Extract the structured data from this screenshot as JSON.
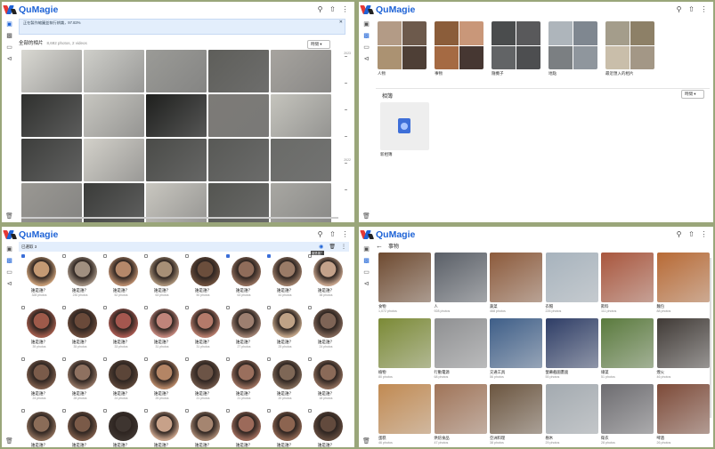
{
  "app": {
    "name": "QuMagie"
  },
  "panel1": {
    "banner_text": "正在製作縮圖並執行辨識，97.83%",
    "banner_sub": "",
    "section_title": "全部的相片",
    "count": "8,692 photos, 2 videos",
    "sort_label": "時間",
    "timeline": [
      "2023",
      "",
      "",
      "",
      "2022",
      ""
    ],
    "photos": [
      "#d9d8d2",
      "#cfcfca",
      "#9b9b97",
      "#5e5e5a",
      "#a7a49f",
      "#2f302e",
      "#c7c6c0",
      "#1e1f1d",
      "#7d7b77",
      "#c5c4bd",
      "#3d3e3c",
      "#d3d1ca",
      "#4a4b48",
      "#585956",
      "#6a6b68",
      "#9a9893",
      "#3a3b39",
      "#c9c7c0",
      "#545551",
      "#a8a7a2"
    ]
  },
  "panel2": {
    "categories": [
      {
        "label": "人物",
        "colors": [
          "#b39b86",
          "#6d5a4c",
          "#ab9272",
          "#4e3f36"
        ]
      },
      {
        "label": "事物",
        "colors": [
          "#8b5d3a",
          "#c99779",
          "#a56a43",
          "#463732"
        ]
      },
      {
        "label": "隨機子",
        "colors": [
          "#4a4c4d",
          "#59595b",
          "#626466",
          "#4d4e50"
        ]
      },
      {
        "label": "地點",
        "colors": [
          "#aeb5bb",
          "#7f8790",
          "#7b7f82",
          "#8f969d"
        ]
      },
      {
        "label": "最近匯入的相片",
        "colors": [
          "#a49d8b",
          "#8d8067",
          "#c9beaa",
          "#a39786"
        ]
      }
    ],
    "album_title": "相簿",
    "sort_label": "時間",
    "album_label": "新相簿"
  },
  "panel3": {
    "selection": "已選取 3",
    "faces": [
      {
        "name": "誰是誰？",
        "count": "328 photos",
        "color": "#c49a74",
        "checked": true
      },
      {
        "name": "誰是誰？",
        "count": "230 photos",
        "color": "#a08f80",
        "checked": false
      },
      {
        "name": "誰是誰？",
        "count": "52 photos",
        "color": "#b5886a",
        "checked": false
      },
      {
        "name": "誰是誰？",
        "count": "63 photos",
        "color": "#a78f76",
        "checked": false
      },
      {
        "name": "誰是誰？",
        "count": "50 photos",
        "color": "#6b4e3c",
        "checked": false
      },
      {
        "name": "誰是誰？",
        "count": "63 photos",
        "color": "#8f6c5a",
        "checked": true
      },
      {
        "name": "誰是誰？",
        "count": "44 photos",
        "color": "#9a7b67",
        "checked": true
      },
      {
        "name": "誰是誰？",
        "count": "38 photos",
        "color": "#c3a18a",
        "checked": false,
        "tip": "誰是誰？"
      },
      {
        "name": "誰是誰？",
        "count": "39 photos",
        "color": "#9e5a4a",
        "checked": false
      },
      {
        "name": "誰是誰？",
        "count": "35 photos",
        "color": "#6a4a3a",
        "checked": false
      },
      {
        "name": "誰是誰？",
        "count": "33 photos",
        "color": "#a4574f",
        "checked": false
      },
      {
        "name": "誰是誰？",
        "count": "31 photos",
        "color": "#c0847a",
        "checked": false
      },
      {
        "name": "誰是誰？",
        "count": "31 photos",
        "color": "#b47a6a",
        "checked": false
      },
      {
        "name": "誰是誰？",
        "count": "27 photos",
        "color": "#9d7f70",
        "checked": false
      },
      {
        "name": "誰是誰？",
        "count": "25 photos",
        "color": "#bfa286",
        "checked": false
      },
      {
        "name": "誰是誰？",
        "count": "24 photos",
        "color": "#7e6456",
        "checked": false
      },
      {
        "name": "誰是誰？",
        "count": "24 photos",
        "color": "#7a5b4a",
        "checked": false
      },
      {
        "name": "誰是誰？",
        "count": "28 photos",
        "color": "#8e7160",
        "checked": false
      },
      {
        "name": "誰是誰？",
        "count": "24 photos",
        "color": "#5b4538",
        "checked": false
      },
      {
        "name": "誰是誰？",
        "count": "25 photos",
        "color": "#b48565",
        "checked": false
      },
      {
        "name": "誰是誰？",
        "count": "21 photos",
        "color": "#6c5446",
        "checked": false
      },
      {
        "name": "誰是誰？",
        "count": "21 photos",
        "color": "#9a6f5d",
        "checked": false
      },
      {
        "name": "誰是誰？",
        "count": "20 photos",
        "color": "#7e6756",
        "checked": false
      },
      {
        "name": "誰是誰？",
        "count": "18 photos",
        "color": "#8a6a58",
        "checked": false
      },
      {
        "name": "誰是誰？",
        "count": "",
        "color": "#8a6c58",
        "checked": false
      },
      {
        "name": "誰是誰？",
        "count": "",
        "color": "#7a5a48",
        "checked": false
      },
      {
        "name": "誰是誰？",
        "count": "",
        "color": "#3e3530",
        "checked": false
      },
      {
        "name": "誰是誰？",
        "count": "",
        "color": "#c7a189",
        "checked": false
      },
      {
        "name": "誰是誰？",
        "count": "",
        "color": "#a58570",
        "checked": false
      },
      {
        "name": "誰是誰？",
        "count": "",
        "color": "#9c6a5a",
        "checked": false
      },
      {
        "name": "誰是誰？",
        "count": "",
        "color": "#8c6450",
        "checked": false
      },
      {
        "name": "誰是誰？",
        "count": "",
        "color": "#624a3d",
        "checked": false
      }
    ]
  },
  "panel4": {
    "title": "事物",
    "things": [
      {
        "name": "食物",
        "count": "1,072 photos",
        "color": "#6e4a30"
      },
      {
        "name": "人",
        "count": "928 photos",
        "color": "#5a5f67"
      },
      {
        "name": "蔬菜",
        "count": "468 photos",
        "color": "#8c5a3b"
      },
      {
        "name": "衣帽",
        "count": "226 photos",
        "color": "#a7b3bd"
      },
      {
        "name": "飲料",
        "count": "111 photos",
        "color": "#a9563d"
      },
      {
        "name": "麵包",
        "count": "88 photos",
        "color": "#b86a35"
      },
      {
        "name": "植物",
        "count": "80 photos",
        "color": "#7b8a36"
      },
      {
        "name": "行動電源",
        "count": "68 photos",
        "color": "#8f9092"
      },
      {
        "name": "交通工具",
        "count": "56 photos",
        "color": "#3e5e88"
      },
      {
        "name": "螢幕截圖畫面",
        "count": "55 photos",
        "color": "#2e3d66"
      },
      {
        "name": "綠菜",
        "count": "51 photos",
        "color": "#5a7a3d"
      },
      {
        "name": "煙火",
        "count": "46 photos",
        "color": "#403a36"
      },
      {
        "name": "蛋糕",
        "count": "46 photos",
        "color": "#c18a52"
      },
      {
        "name": "烘焙食品",
        "count": "47 photos",
        "color": "#a07458"
      },
      {
        "name": "亞洲料理",
        "count": "38 photos",
        "color": "#6b553f"
      },
      {
        "name": "樹木",
        "count": "29 photos",
        "color": "#a3aab0"
      },
      {
        "name": "衛衣",
        "count": "28 photos",
        "color": "#6d6c70"
      },
      {
        "name": "啤酒",
        "count": "26 photos",
        "color": "#7d4a38"
      }
    ]
  }
}
